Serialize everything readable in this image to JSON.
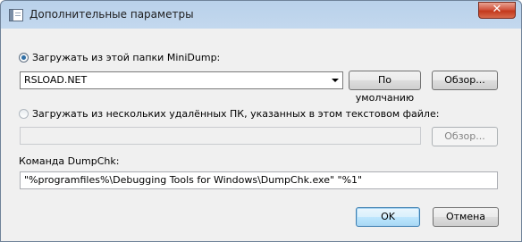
{
  "window": {
    "title": "Дополнительные параметры",
    "close_symbol": "✕"
  },
  "minidump": {
    "option_label": "Загружать из этой папки MiniDump:",
    "selected": true,
    "folder_value": "RSLOAD.NET",
    "default_button": "По умолчанию",
    "browse_button": "Обзор..."
  },
  "remote": {
    "option_label": "Загружать из нескольких удалённых ПК, указанных в этом текстовом файле:",
    "selected": false,
    "file_value": "",
    "browse_button": "Обзор..."
  },
  "dumpchk": {
    "label": "Команда DumpChk:",
    "command_value": "\"%programfiles%\\Debugging Tools for Windows\\DumpChk.exe\" \"%1\""
  },
  "footer": {
    "ok_button": "OK",
    "cancel_button": "Отмена"
  }
}
